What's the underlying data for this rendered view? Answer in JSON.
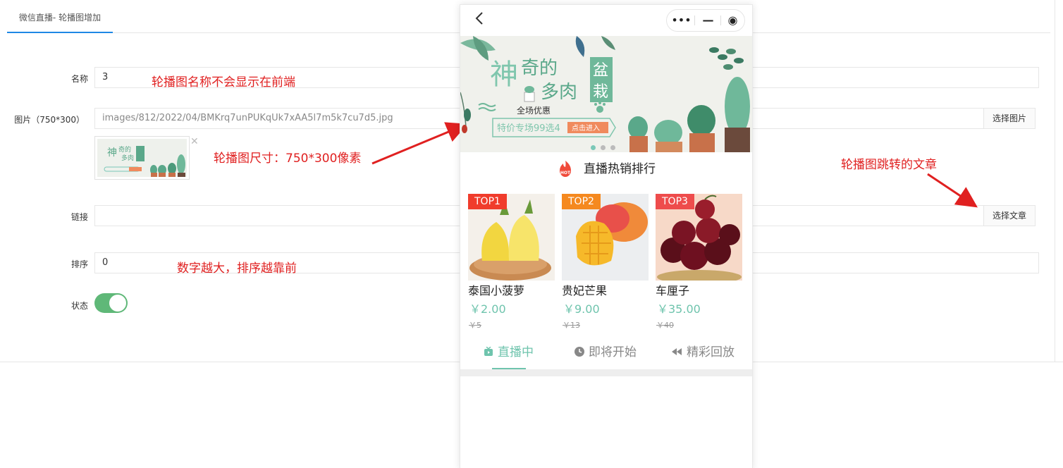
{
  "tab": {
    "label": "微信直播- 轮播图增加"
  },
  "form": {
    "name": {
      "label": "名称",
      "value": "3"
    },
    "image": {
      "label": "图片（750*300）",
      "value": "images/812/2022/04/BMKrq7unPUKqUk7xAA5l7m5k7cu7d5.jpg",
      "button": "选择图片"
    },
    "link": {
      "label": "链接",
      "value": "",
      "button": "选择文章"
    },
    "sort": {
      "label": "排序",
      "value": "0"
    },
    "status": {
      "label": "状态",
      "on": true
    }
  },
  "annotations": {
    "name": "轮播图名称不会显示在前端",
    "size": "轮播图尺寸：750*300像素",
    "link": "轮播图跳转的文章",
    "sort": "数字越大，排序越靠前"
  },
  "colors": {
    "accent_green": "#5fb878",
    "price_green": "#6fc4ad",
    "annotation_red": "#e02020",
    "tab_blue": "#1e88e5"
  },
  "phone": {
    "back_icon": "chevron-left-icon",
    "capsule": {
      "more": "•••",
      "minimize": "—",
      "close": "◉"
    },
    "banner": {
      "title_chars": [
        "神",
        "奇的",
        "多肉"
      ],
      "box_chars": [
        "盆",
        "栽"
      ],
      "sub": "全场优惠",
      "promo": "特价专场99选4",
      "cta": "点击进入"
    },
    "hot": {
      "title": "直播热销排行",
      "badge": "HOT"
    },
    "products": [
      {
        "tag": "TOP1",
        "tag_color": "#f03c2c",
        "name": "泰国小菠萝",
        "price": "￥2.00",
        "old": "￥5"
      },
      {
        "tag": "TOP2",
        "tag_color": "#f5891f",
        "name": "贵妃芒果",
        "price": "￥9.00",
        "old": "￥13"
      },
      {
        "tag": "TOP3",
        "tag_color": "#ee4c4c",
        "name": "车厘子",
        "price": "￥35.00",
        "old": "￥40"
      }
    ],
    "live_tabs": [
      "直播中",
      "即将开始",
      "精彩回放"
    ]
  }
}
